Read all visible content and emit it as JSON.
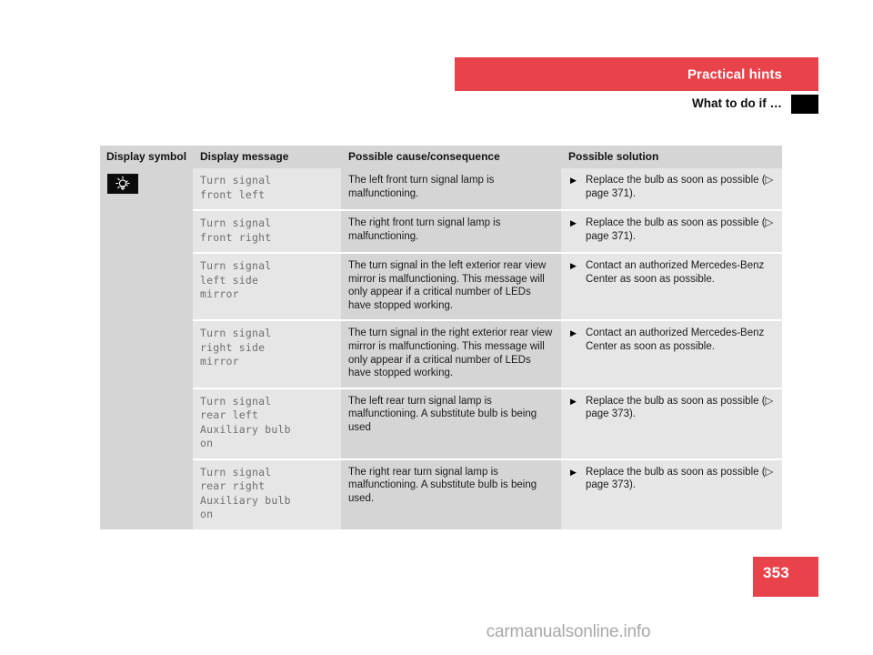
{
  "header": {
    "chapter_title": "Practical hints",
    "section_title": "What to do if …",
    "band_color": "#e8424a",
    "thumb_tab_color": "#000000"
  },
  "table": {
    "columns": [
      {
        "key": "symbol",
        "label": "Display symbol"
      },
      {
        "key": "message",
        "label": "Display message"
      },
      {
        "key": "cause",
        "label": "Possible cause/consequence"
      },
      {
        "key": "solution",
        "label": "Possible solution"
      }
    ],
    "symbol_icon": {
      "name": "bulb-indicator-icon",
      "description": "bulb-lamp-warning-symbol",
      "background": "#0b0b0b",
      "glyph_color": "#ffffff"
    },
    "rows": [
      {
        "message": "Turn signal\nfront left",
        "cause": "The left front turn signal lamp is malfunctioning.",
        "solution_bullet": "▶",
        "solution": "Replace the bulb as soon as possible (▷ page 371)."
      },
      {
        "message": "Turn signal\nfront right",
        "cause": "The right front turn signal lamp is malfunctioning.",
        "solution_bullet": "▶",
        "solution": "Replace the bulb as soon as possible (▷ page 371)."
      },
      {
        "message": "Turn signal\nleft side\nmirror",
        "cause": "The turn signal in the left exterior rear view mirror is malfunctioning. This message will only appear if a critical number of LEDs have stopped working.",
        "solution_bullet": "▶",
        "solution": "Contact an authorized Mercedes-Benz Center as soon as possible."
      },
      {
        "message": "Turn signal\nright side\nmirror",
        "cause": "The turn signal in the right exterior rear view mirror is malfunctioning. This message will only appear if a critical number of LEDs have stopped working.",
        "solution_bullet": "▶",
        "solution": "Contact an authorized Mercedes-Benz Center as soon as possible."
      },
      {
        "message": "Turn signal\nrear left\nAuxiliary bulb\non",
        "cause": "The left rear turn signal lamp is malfunctioning. A substitute bulb is being used",
        "solution_bullet": "▶",
        "solution": "Replace the bulb as soon as possible (▷ page 373)."
      },
      {
        "message": "Turn signal\nrear right\nAuxiliary bulb\non",
        "cause": "The right rear turn signal lamp is malfunctioning. A substitute bulb is being used.",
        "solution_bullet": "▶",
        "solution": "Replace the bulb as soon as possible (▷ page 373)."
      }
    ]
  },
  "footer": {
    "page_number": "353",
    "page_badge_color": "#e8424a",
    "watermark": "carmanualsonline.info"
  }
}
